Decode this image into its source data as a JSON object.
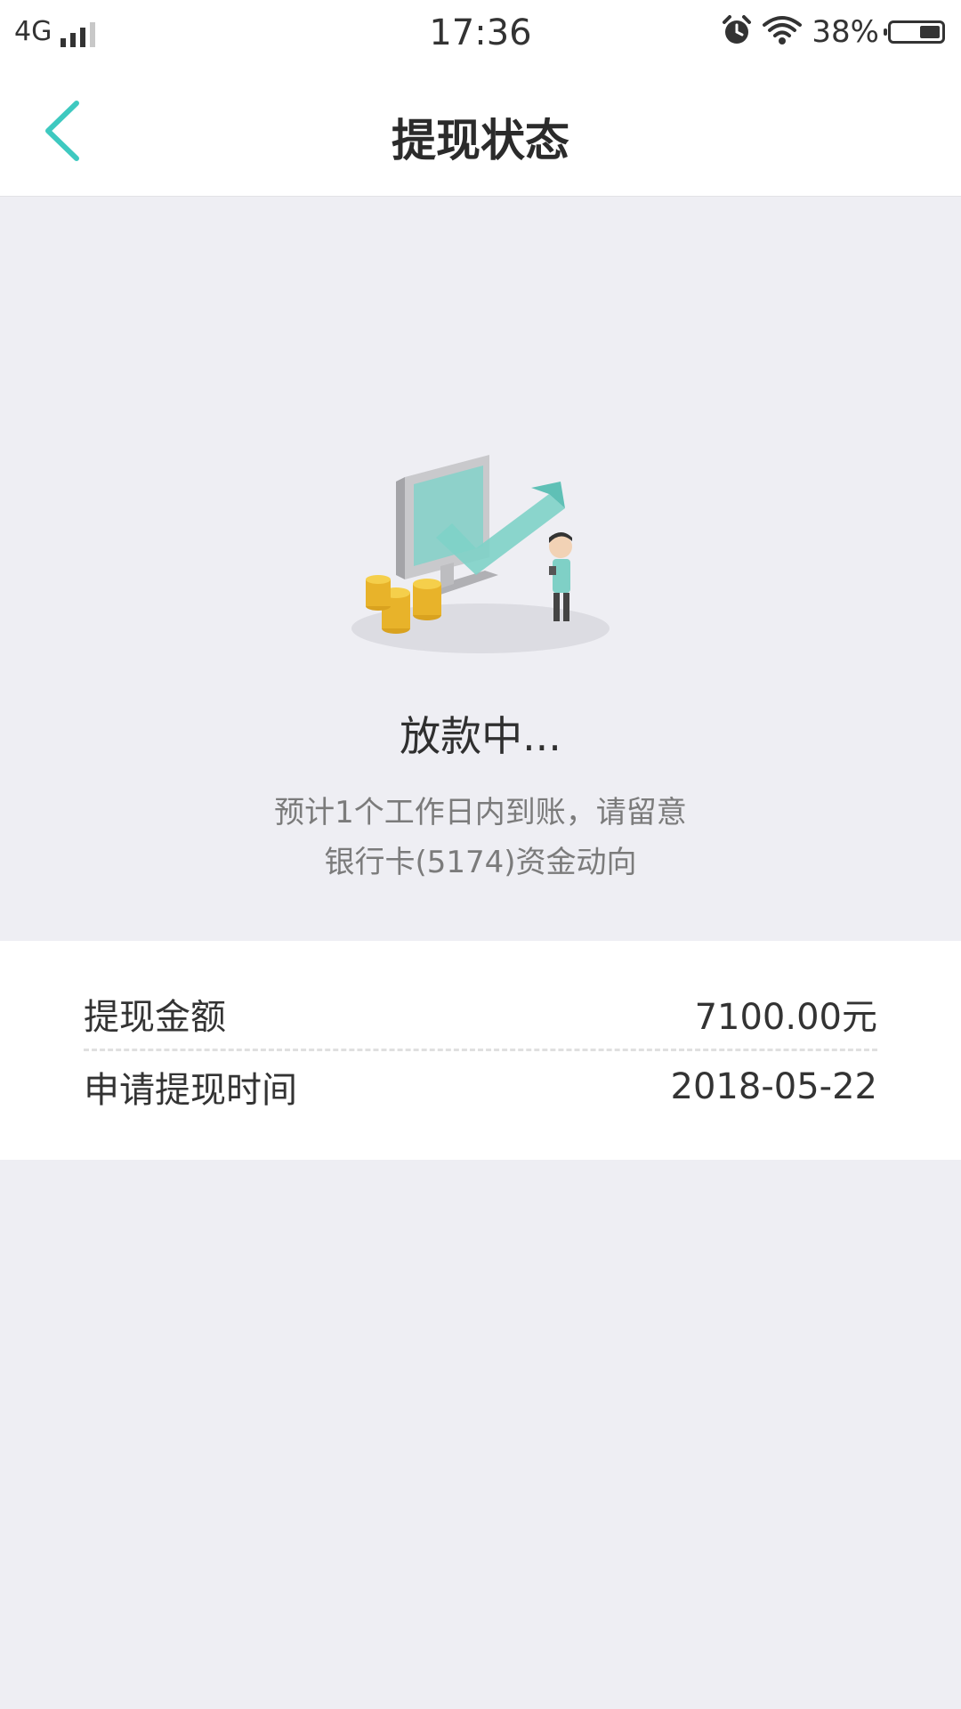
{
  "status_bar": {
    "network": "4G",
    "time": "17:36",
    "battery_percent": "38%",
    "icons": [
      "signal-icon",
      "alarm-icon",
      "wifi-icon",
      "battery-icon"
    ]
  },
  "navbar": {
    "title": "提现状态",
    "back_icon": "chevron-left-icon"
  },
  "status": {
    "illustration": "withdraw-processing-illustration",
    "title": "放款中...",
    "line1": "预计1个工作日内到账，请留意",
    "line2": "银行卡(5174)资金动向"
  },
  "details": {
    "rows": [
      {
        "label": "提现金额",
        "value": "7100.00元"
      },
      {
        "label": "申请提现时间",
        "value": "2018-05-22"
      }
    ]
  },
  "colors": {
    "accent": "#3ec9c0",
    "background": "#eeeef3",
    "card": "#ffffff"
  }
}
